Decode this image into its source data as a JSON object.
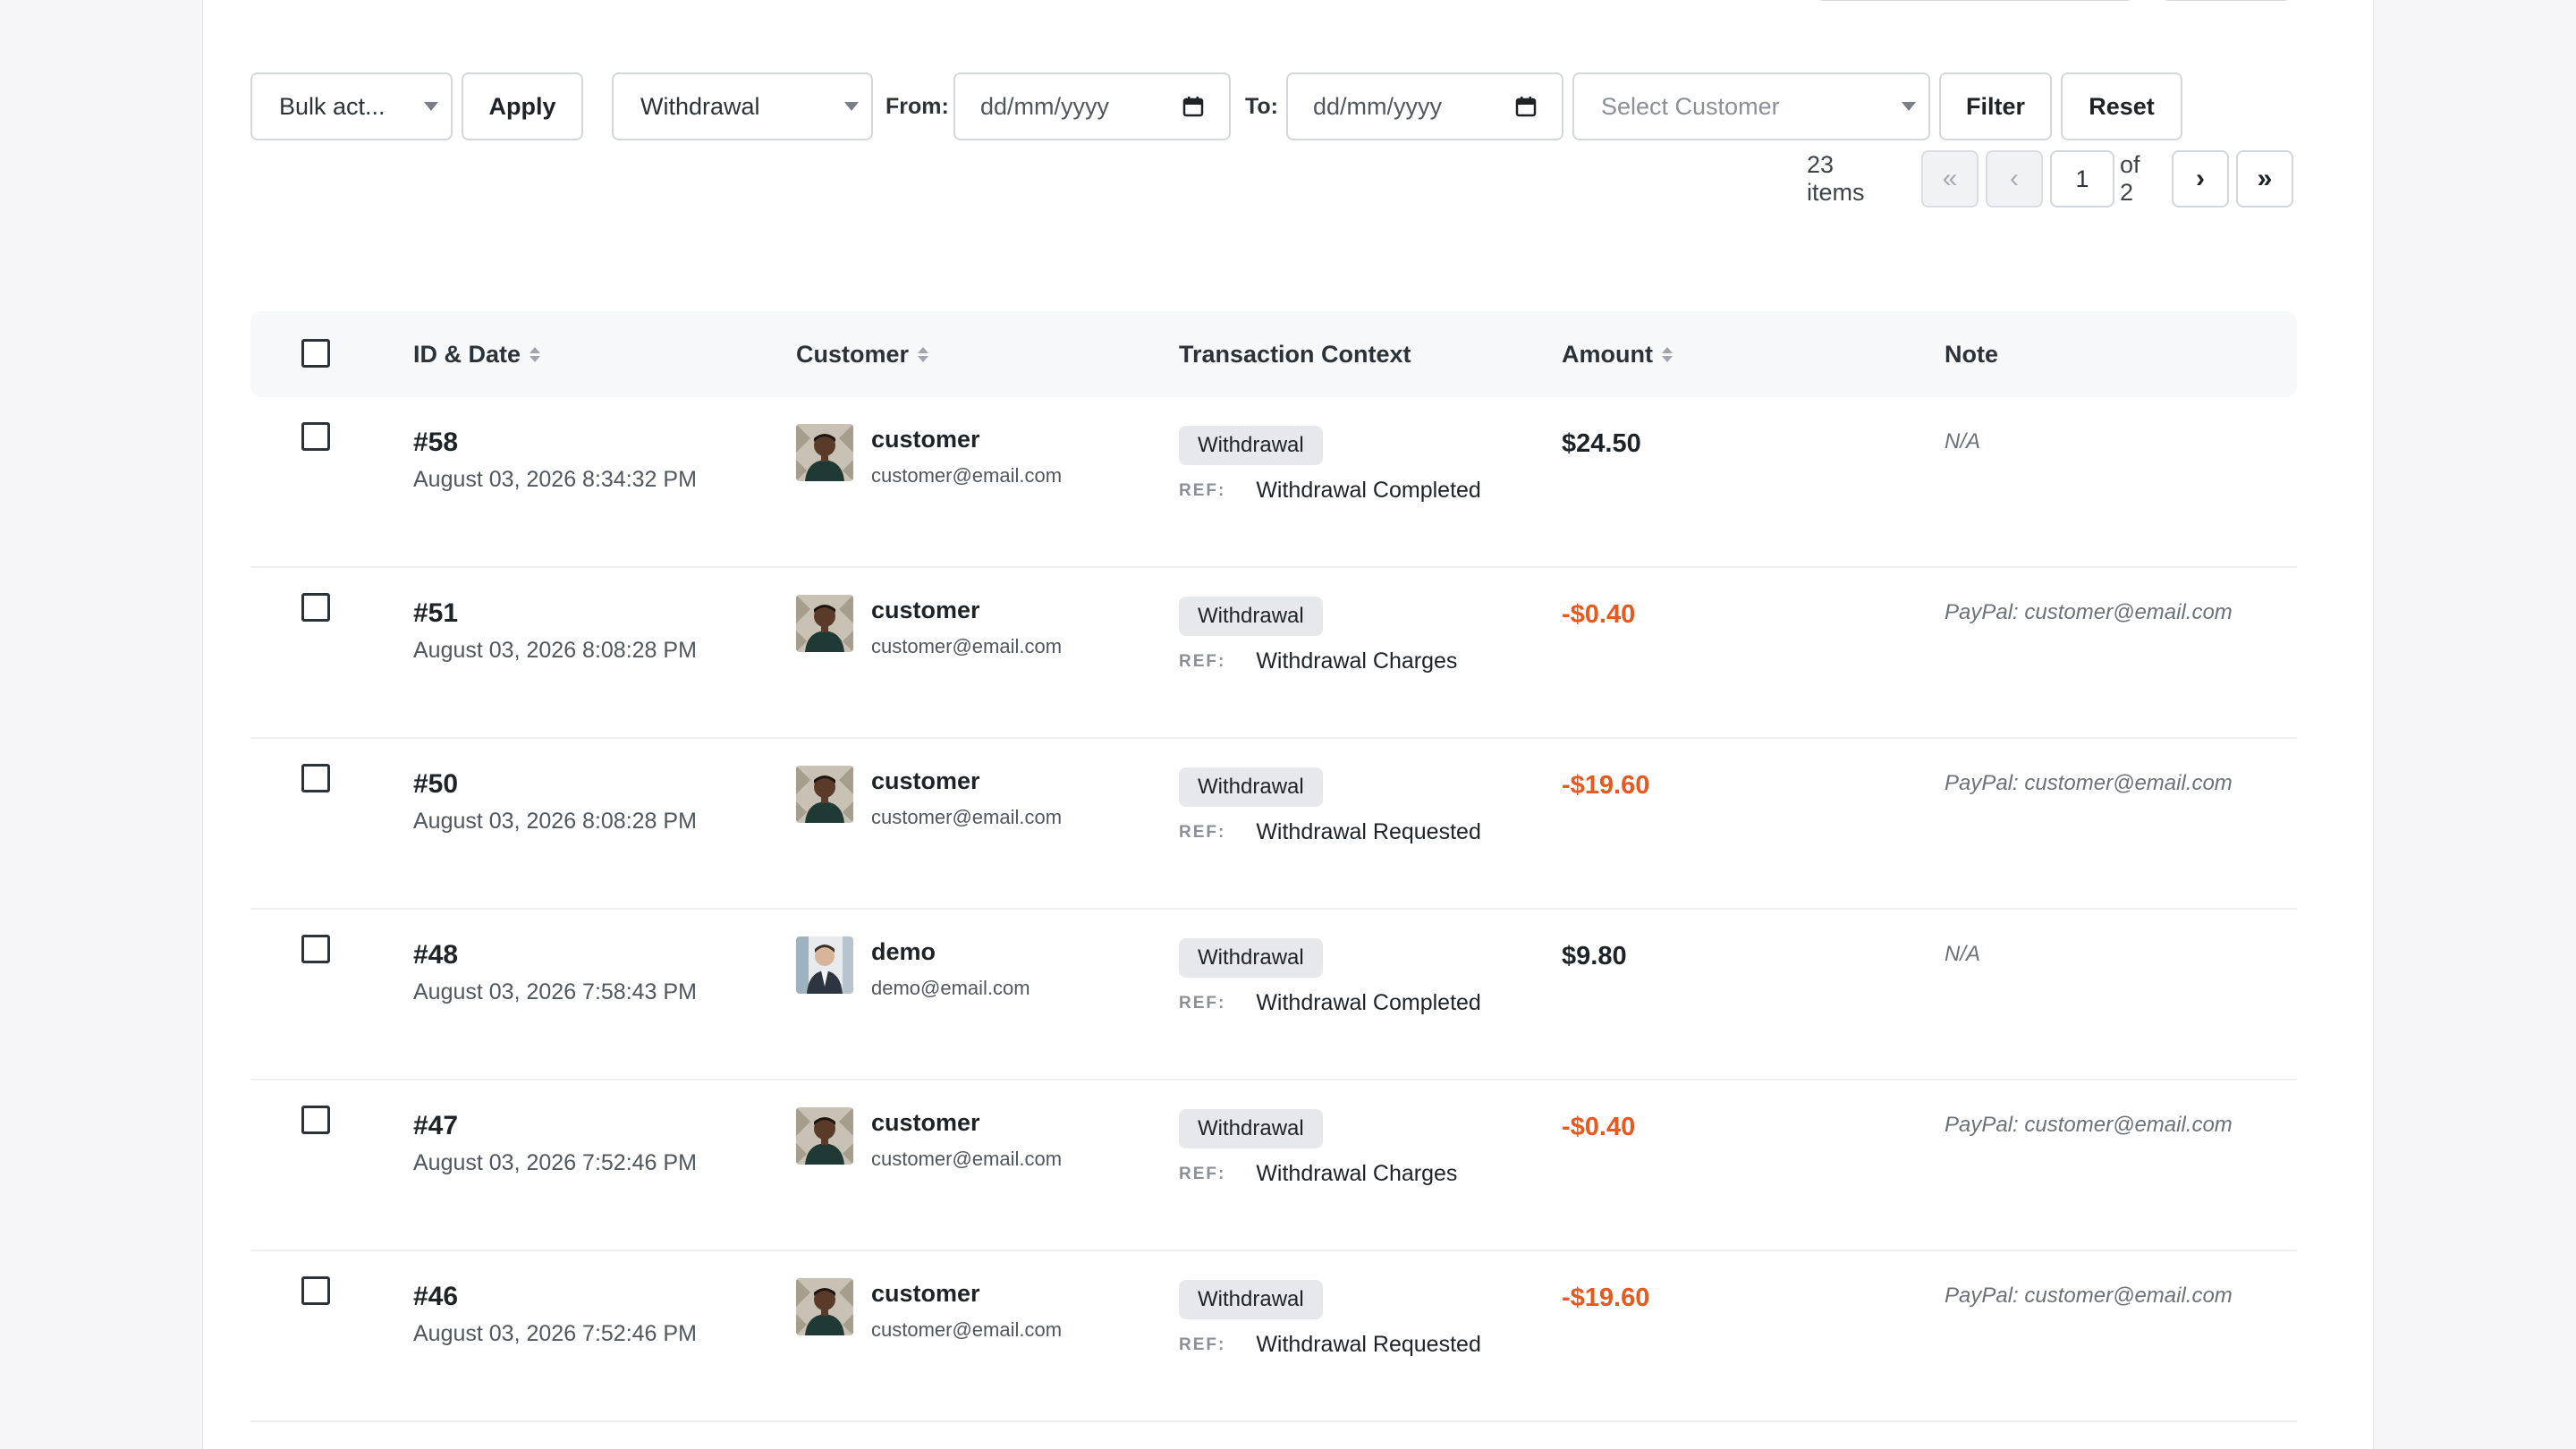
{
  "colors": {
    "negative_amount": "#e9591f",
    "positive_amount": "#1d2327",
    "badge_bg": "#e6e8ec"
  },
  "toolbar": {
    "bulk_action": "Bulk act...",
    "apply_label": "Apply",
    "type_filter": "Withdrawal",
    "from_label": "From:",
    "from_placeholder": "dd/mm/yyyy",
    "to_label": "To:",
    "to_placeholder": "dd/mm/yyyy",
    "customer_placeholder": "Select Customer",
    "filter_label": "Filter",
    "reset_label": "Reset"
  },
  "pagination": {
    "items_count": "23 items",
    "first": "«",
    "prev": "‹",
    "current_page": "1",
    "of_label": "of 2",
    "next": "›",
    "last": "»"
  },
  "table": {
    "headers": {
      "id_date": "ID & Date",
      "customer": "Customer",
      "context": "Transaction Context",
      "amount": "Amount",
      "note": "Note"
    },
    "ref_label": "REF:",
    "rows": [
      {
        "id": "#58",
        "date": "August 03, 2026 8:34:32 PM",
        "name": "customer",
        "email": "customer@email.com",
        "avatar": "customer-avatar-icon",
        "type": "Withdrawal",
        "ref": "Withdrawal Completed",
        "amount": "$24.50",
        "negative": false,
        "note": "N/A"
      },
      {
        "id": "#51",
        "date": "August 03, 2026 8:08:28 PM",
        "name": "customer",
        "email": "customer@email.com",
        "avatar": "customer-avatar-icon",
        "type": "Withdrawal",
        "ref": "Withdrawal Charges",
        "amount": "-$0.40",
        "negative": true,
        "note": "PayPal: customer@email.com"
      },
      {
        "id": "#50",
        "date": "August 03, 2026 8:08:28 PM",
        "name": "customer",
        "email": "customer@email.com",
        "avatar": "customer-avatar-icon",
        "type": "Withdrawal",
        "ref": "Withdrawal Requested",
        "amount": "-$19.60",
        "negative": true,
        "note": "PayPal: customer@email.com"
      },
      {
        "id": "#48",
        "date": "August 03, 2026 7:58:43 PM",
        "name": "demo",
        "email": "demo@email.com",
        "avatar": "demo-avatar-icon",
        "type": "Withdrawal",
        "ref": "Withdrawal Completed",
        "amount": "$9.80",
        "negative": false,
        "note": "N/A"
      },
      {
        "id": "#47",
        "date": "August 03, 2026 7:52:46 PM",
        "name": "customer",
        "email": "customer@email.com",
        "avatar": "customer-avatar-icon",
        "type": "Withdrawal",
        "ref": "Withdrawal Charges",
        "amount": "-$0.40",
        "negative": true,
        "note": "PayPal: customer@email.com"
      },
      {
        "id": "#46",
        "date": "August 03, 2026 7:52:46 PM",
        "name": "customer",
        "email": "customer@email.com",
        "avatar": "customer-avatar-icon",
        "type": "Withdrawal",
        "ref": "Withdrawal Requested",
        "amount": "-$19.60",
        "negative": true,
        "note": "PayPal: customer@email.com"
      }
    ]
  }
}
